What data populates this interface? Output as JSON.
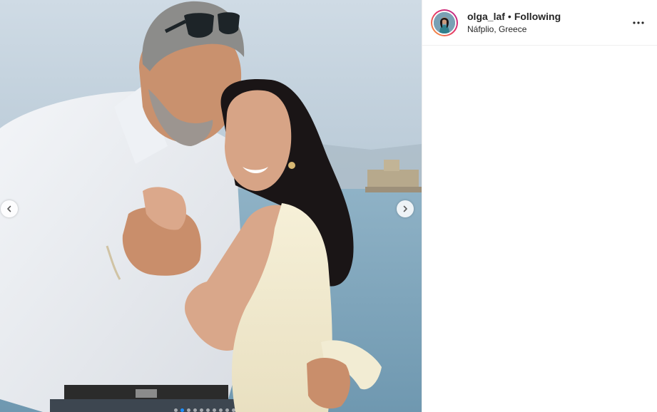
{
  "post": {
    "username": "olga_laf",
    "separator": "•",
    "follow_status": "Following",
    "location": "Náfplio, Greece"
  },
  "carousel": {
    "slide_count": 10,
    "active_index": 1
  },
  "colors": {
    "active_dot": "#1e90ff",
    "text": "#262626",
    "border": "#efefef"
  },
  "icons": {
    "prev": "chevron-left-icon",
    "next": "chevron-right-icon",
    "more": "more-options-icon"
  }
}
